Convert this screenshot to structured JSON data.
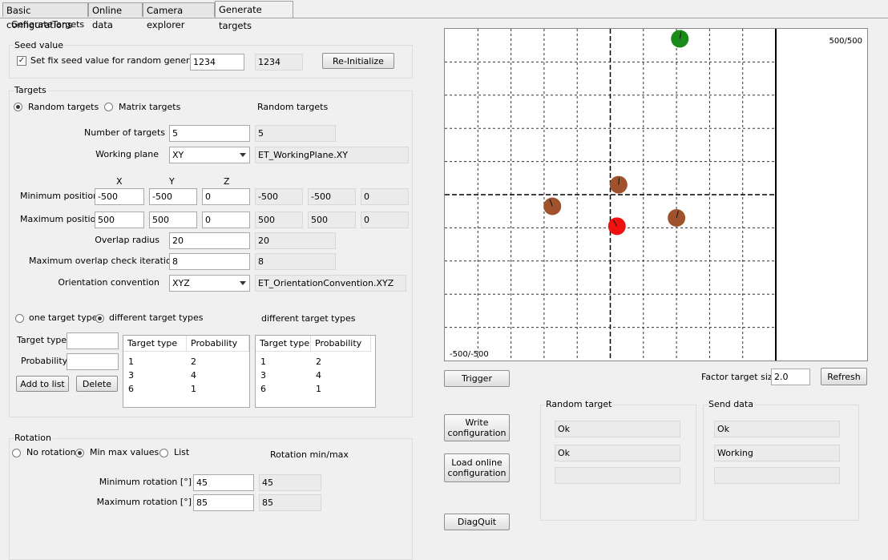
{
  "tabs": [
    "Basic configurations",
    "Online data",
    "Camera explorer",
    "Generate targets"
  ],
  "panel_title": "GenerateTargets",
  "seed": {
    "title": "Seed value",
    "checkbox_label": "Set fix seed value for random generator",
    "value": "1234",
    "readout": "1234",
    "reinit_label": "Re-Initialize"
  },
  "targets": {
    "title": "Targets",
    "random_label": "Random targets",
    "matrix_label": "Matrix targets",
    "mode_readout": "Random targets",
    "num_label": "Number of targets",
    "num_value": "5",
    "num_readout": "5",
    "plane_label": "Working plane",
    "plane_value": "XY",
    "plane_readout": "ET_WorkingPlane.XY",
    "col_x": "X",
    "col_y": "Y",
    "col_z": "Z",
    "min_label": "Minimum position",
    "min_values": [
      "-500",
      "-500",
      "0"
    ],
    "min_readout": [
      "-500",
      "-500",
      "0"
    ],
    "max_label": "Maximum position",
    "max_values": [
      "500",
      "500",
      "0"
    ],
    "max_readout": [
      "500",
      "500",
      "0"
    ],
    "overlap_label": "Overlap radius",
    "overlap_value": "20",
    "overlap_readout": "20",
    "iter_label": "Maximum overlap check iterations",
    "iter_value": "8",
    "iter_readout": "8",
    "orient_label": "Orientation convention",
    "orient_value": "XYZ",
    "orient_readout": "ET_OrientationConvention.XYZ",
    "one_type_label": "one target type",
    "diff_types_label": "different target types",
    "types_readout": "different target types",
    "type_label": "Target type",
    "prob_label": "Probability",
    "add_label": "Add to list",
    "delete_label": "Delete",
    "table_headers": [
      "Target type",
      "Probability"
    ],
    "table_rows": [
      [
        "1",
        "2"
      ],
      [
        "3",
        "4"
      ],
      [
        "6",
        "1"
      ]
    ],
    "table2_rows": [
      [
        "1",
        "2"
      ],
      [
        "3",
        "4"
      ],
      [
        "6",
        "1"
      ]
    ]
  },
  "rotation": {
    "title": "Rotation",
    "none_label": "No rotation",
    "minmax_label": "Min max values",
    "list_label": "List",
    "mode_readout": "Rotation min/max",
    "min_label": "Minimum rotation [°]",
    "min_value": "45",
    "min_readout": "45",
    "max_label": "Maximum rotation [°]",
    "max_value": "85",
    "max_readout": "85"
  },
  "plot": {
    "top_right": "500/500",
    "bottom_left": "-500/-500",
    "xlim": [
      -500,
      500
    ],
    "ylim": [
      -500,
      500
    ],
    "targets": [
      {
        "x": 210,
        "y": 470,
        "color": "#1a8a1a",
        "angle": 10
      },
      {
        "x": 25,
        "y": 30,
        "color": "#a0522d",
        "angle": 5
      },
      {
        "x": -175,
        "y": -35,
        "color": "#a0522d",
        "angle": -20
      },
      {
        "x": 200,
        "y": -70,
        "color": "#a0522d",
        "angle": 15
      },
      {
        "x": 20,
        "y": -95,
        "color": "#ee1111",
        "angle": -30
      }
    ]
  },
  "controls": {
    "trigger_label": "Trigger",
    "factor_label": "Factor target size",
    "factor_value": "2.0",
    "refresh_label": "Refresh",
    "write_label_1": "Write",
    "write_label_2": "configuration",
    "load_label_1": "Load online",
    "load_label_2": "configuration",
    "diagquit_label": "DiagQuit"
  },
  "random_target": {
    "title": "Random target",
    "status": [
      "Ok",
      "Ok",
      ""
    ]
  },
  "send_data": {
    "title": "Send data",
    "status": [
      "Ok",
      "Working",
      ""
    ]
  }
}
